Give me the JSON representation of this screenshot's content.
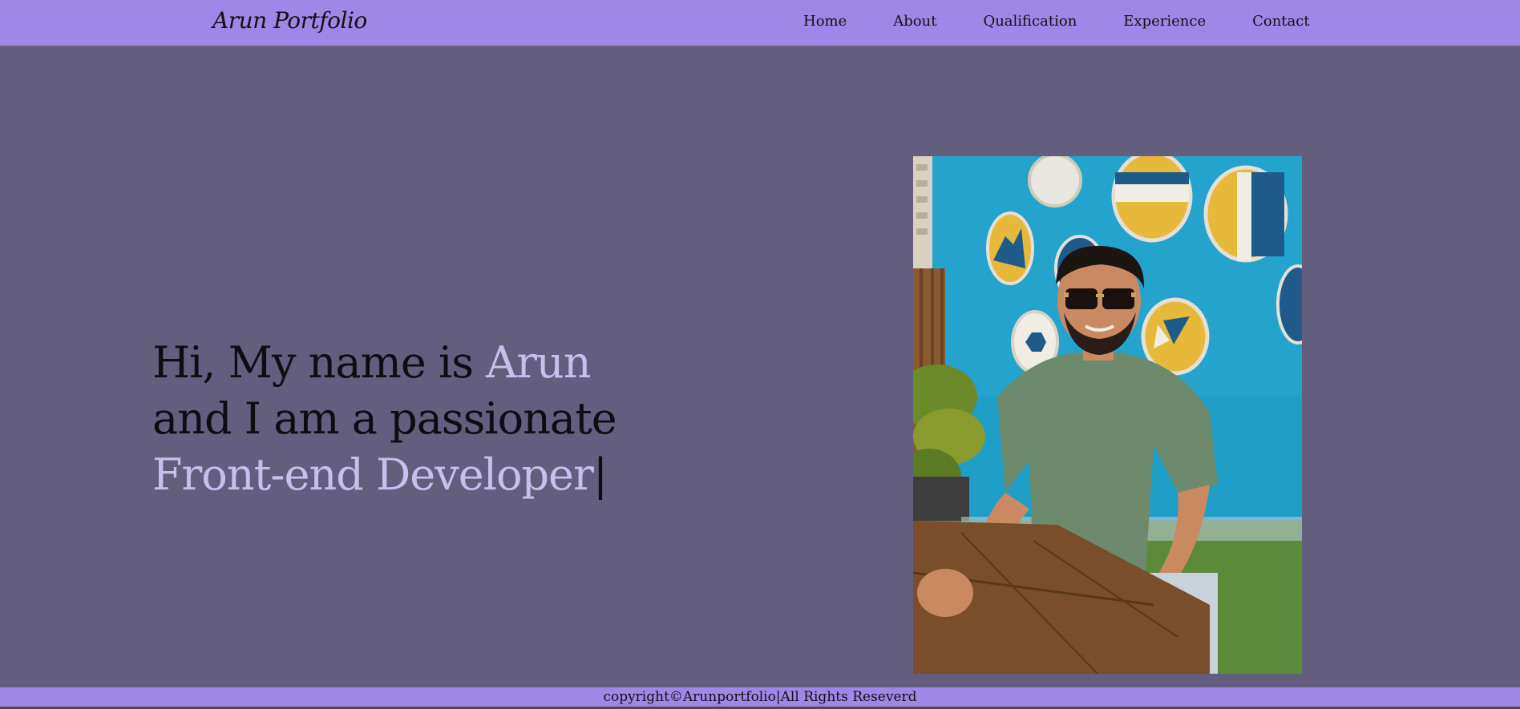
{
  "header": {
    "brand": "Arun Portfolio",
    "nav": [
      {
        "label": "Home"
      },
      {
        "label": "About"
      },
      {
        "label": "Qualification"
      },
      {
        "label": "Experience"
      },
      {
        "label": "Contact"
      }
    ]
  },
  "hero": {
    "line1_prefix": "Hi, My name is ",
    "name": "Arun",
    "line2": "and I am a passionate",
    "role": "Front-end Developer",
    "cursor": "|"
  },
  "footer": {
    "text": "copyright©Arunportfolio|All Rights Reseverd"
  },
  "colors": {
    "navbar": "#9f87e8",
    "background": "#635e7d",
    "accent": "#c7bfee"
  }
}
